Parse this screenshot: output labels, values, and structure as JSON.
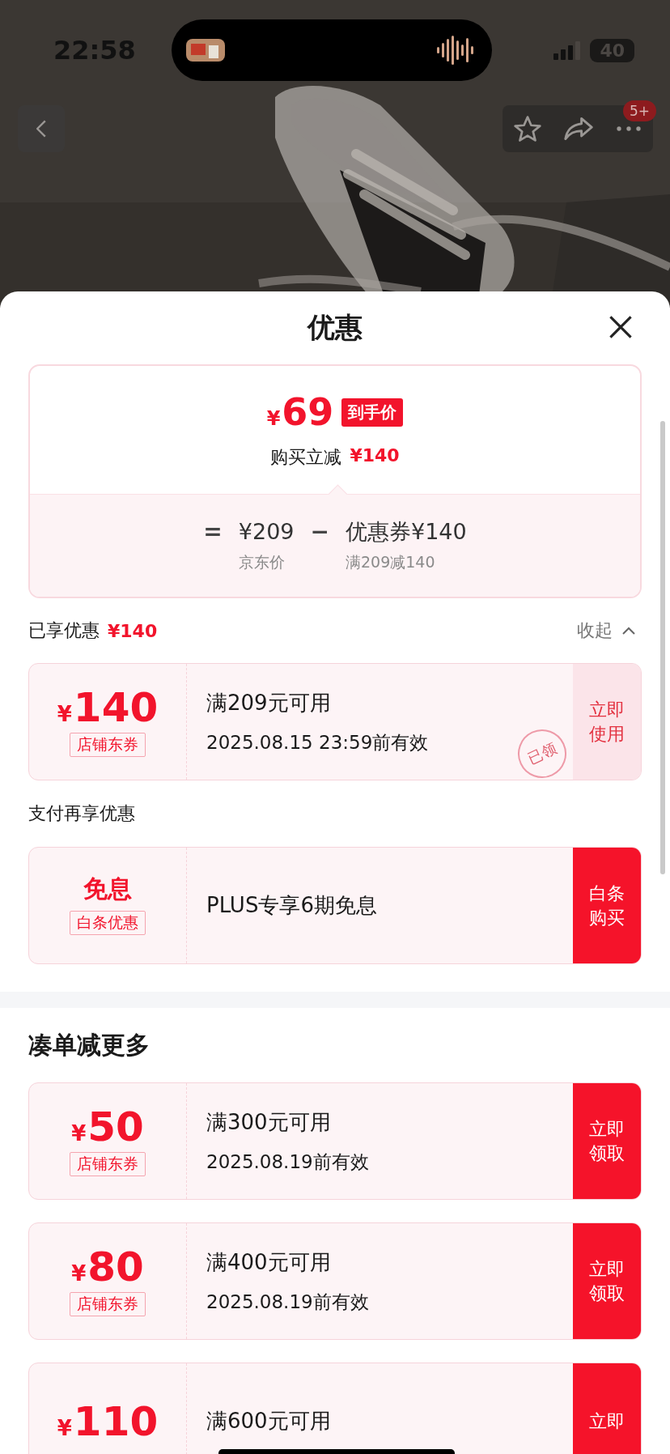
{
  "status_bar": {
    "time": "22:58",
    "battery": "40"
  },
  "header": {
    "badge": "5+"
  },
  "sheet": {
    "title": "优惠"
  },
  "summary": {
    "currency": "¥",
    "final_price": "69",
    "final_tag": "到手价",
    "saving_label": "购买立减",
    "saving_amount": "¥140",
    "equals": "=",
    "list_price": "¥209",
    "minus": "−",
    "coupon_label": "优惠券¥140",
    "list_price_caption": "京东价",
    "coupon_caption": "满209减140"
  },
  "enjoyed": {
    "label": "已享优惠",
    "amount": "¥140",
    "toggle": "收起",
    "expanded": true
  },
  "applied_coupons": [
    {
      "kind": "amount",
      "currency": "¥",
      "amount": "140",
      "tag": "店铺东券",
      "condition": "满209元可用",
      "validity": "2025.08.15 23:59前有效",
      "button": "立即使用",
      "claimed": true,
      "stamp": "已领"
    }
  ],
  "payment_title": "支付再享优惠",
  "payment_offers": [
    {
      "kind": "text",
      "title": "免息",
      "tag": "白条优惠",
      "condition": "PLUS专享6期免息",
      "button": "白条购买",
      "claimed": false
    }
  ],
  "more_title": "凑单减更多",
  "more_coupons": [
    {
      "kind": "amount",
      "currency": "¥",
      "amount": "50",
      "tag": "店铺东券",
      "condition": "满300元可用",
      "validity": "2025.08.19前有效",
      "button": "立即领取",
      "claimed": false
    },
    {
      "kind": "amount",
      "currency": "¥",
      "amount": "80",
      "tag": "店铺东券",
      "condition": "满400元可用",
      "validity": "2025.08.19前有效",
      "button": "立即领取",
      "claimed": false
    },
    {
      "kind": "amount",
      "currency": "¥",
      "amount": "110",
      "condition": "满600元可用",
      "button": "立即",
      "claimed": false
    }
  ]
}
